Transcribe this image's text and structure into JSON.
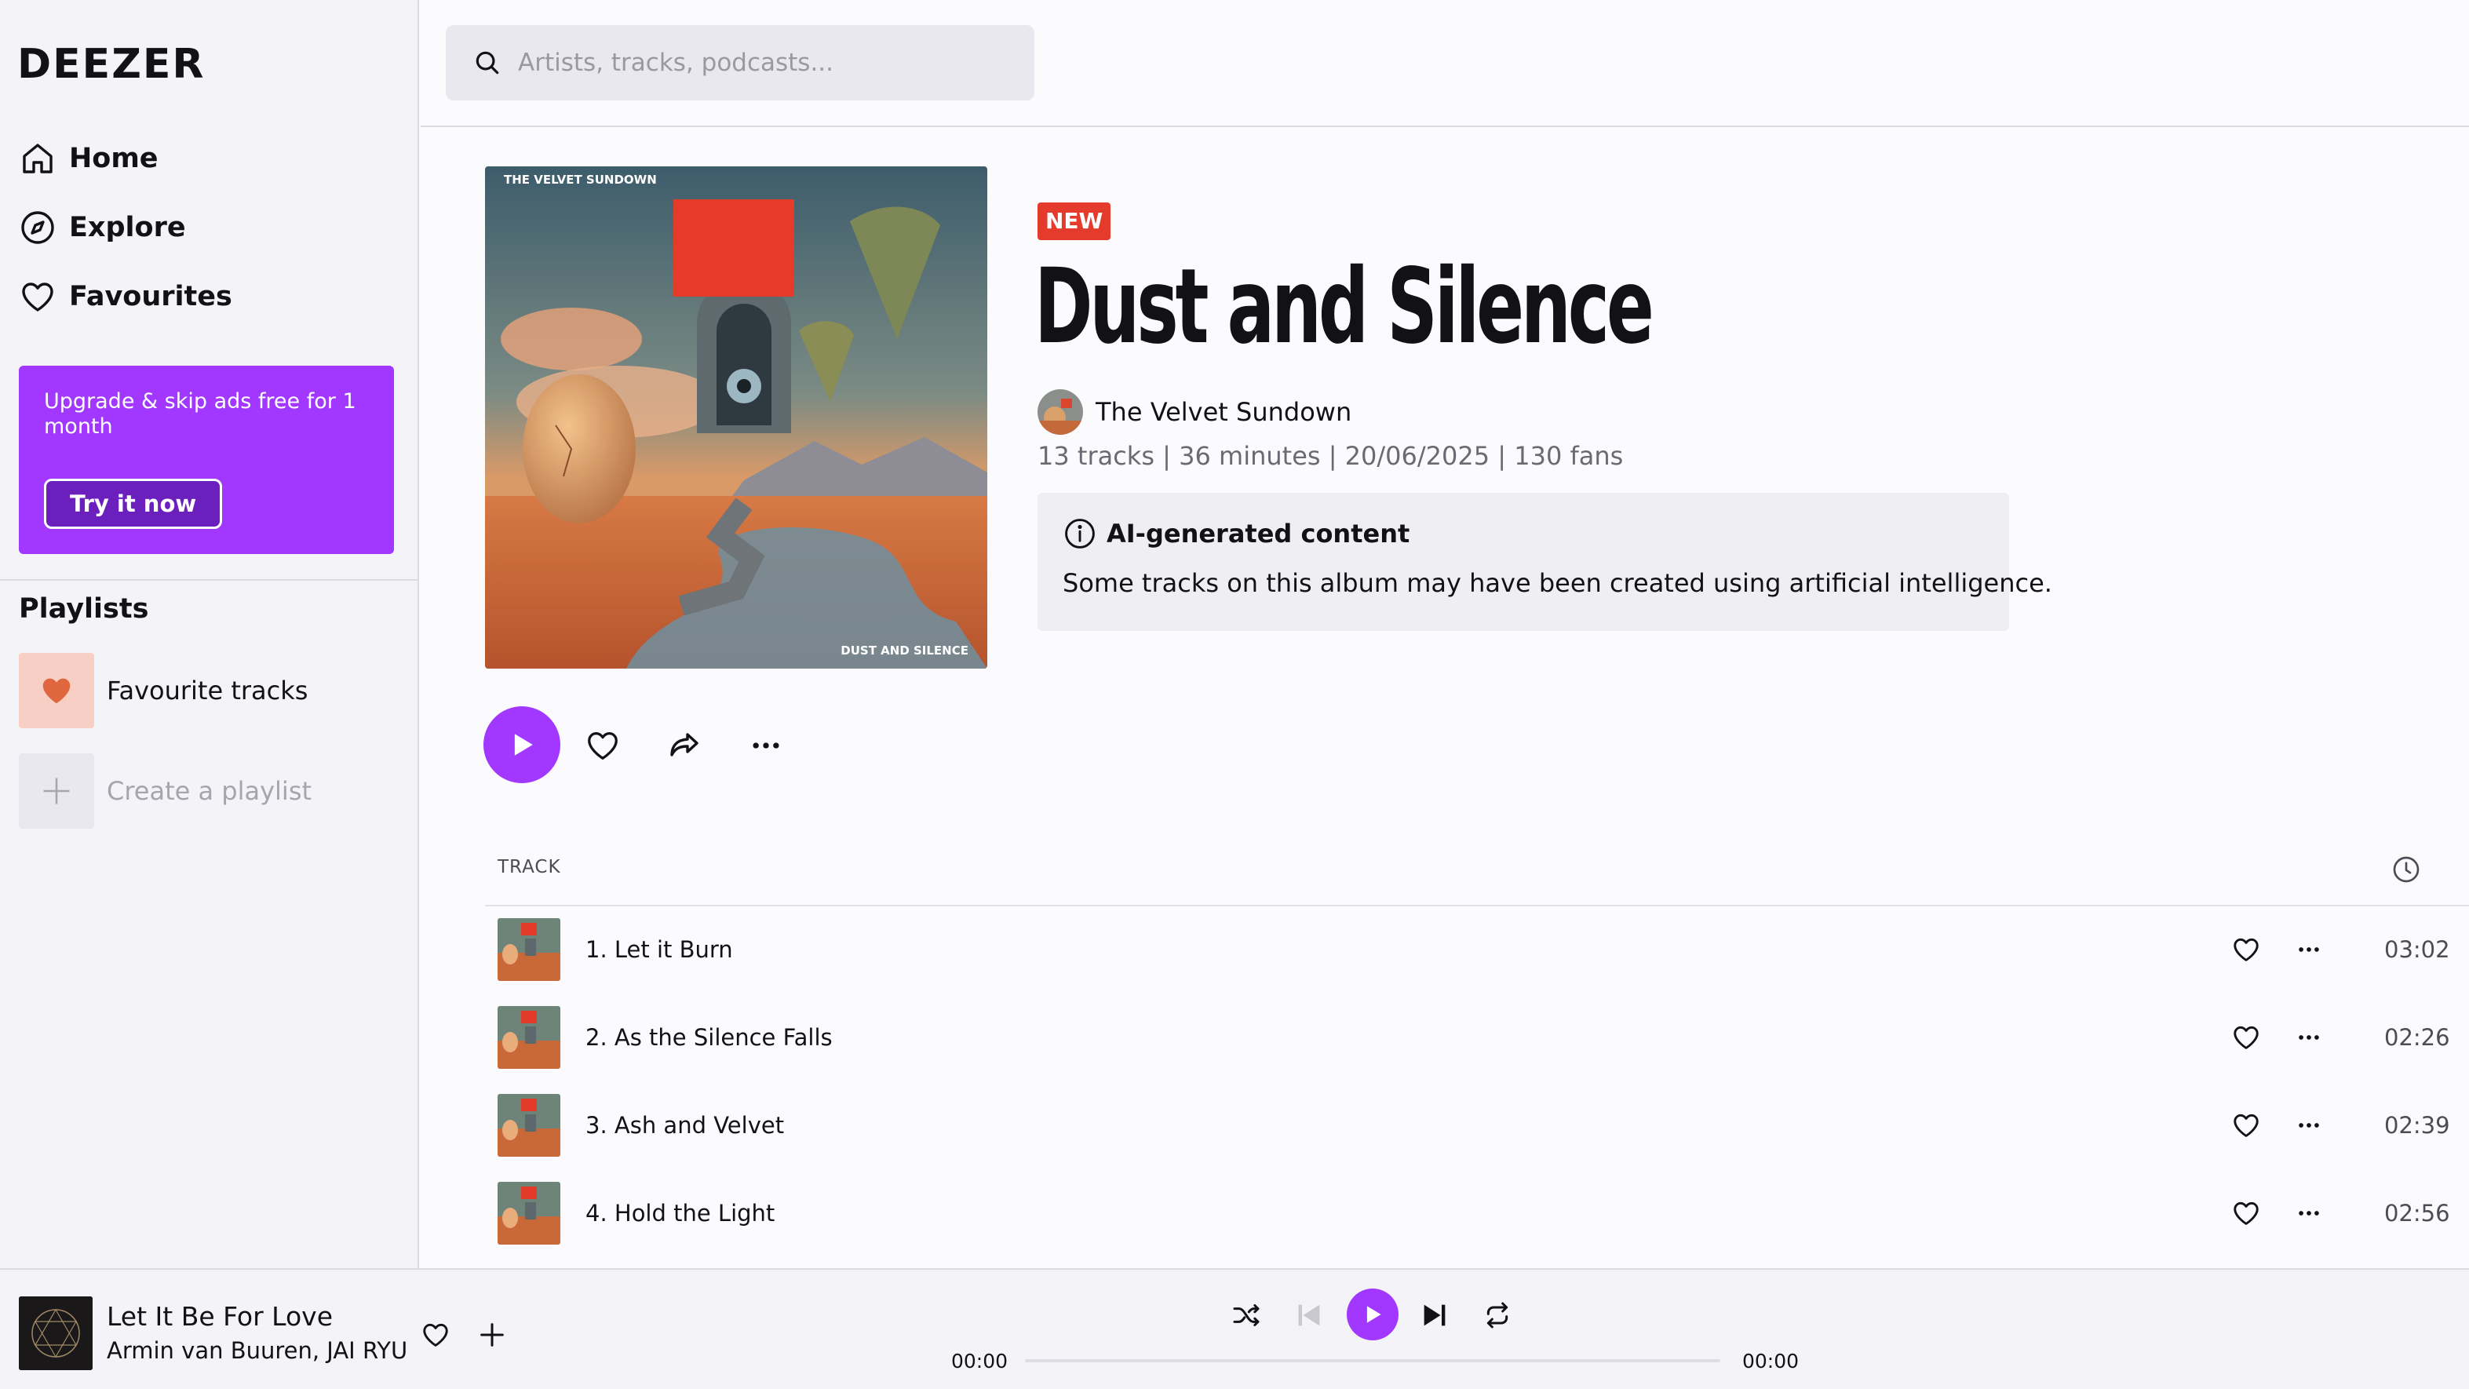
{
  "app": {
    "logo": "DEEZER",
    "accent_color": "#a238ff"
  },
  "sidebar": {
    "nav": [
      {
        "label": "Home",
        "icon": "home-icon"
      },
      {
        "label": "Explore",
        "icon": "compass-icon"
      },
      {
        "label": "Favourites",
        "icon": "heart-icon"
      }
    ],
    "promo": {
      "text": "Upgrade & skip ads free for 1 month",
      "button": "Try it now"
    },
    "playlists_title": "Playlists",
    "playlists": [
      {
        "label": "Favourite tracks",
        "icon": "heart-icon"
      },
      {
        "label": "Create a playlist",
        "icon": "plus-icon"
      }
    ]
  },
  "search": {
    "placeholder": "Artists, tracks, podcasts..."
  },
  "album": {
    "badge": "NEW",
    "title": "Dust and Silence",
    "artist": "The Velvet Sundown",
    "meta": "13 tracks | 36 minutes | 20/06/2025 | 130 fans",
    "cover_top_text": "THE VELVET SUNDOWN",
    "cover_bottom_text": "DUST AND SILENCE",
    "ai_notice": {
      "title": "AI-generated content",
      "body": "Some tracks on this album may have been created using artificial intelligence."
    }
  },
  "tracklist": {
    "column_track": "TRACK",
    "duration_icon": "clock-icon",
    "tracks": [
      {
        "title": "1. Let it Burn",
        "duration": "03:02"
      },
      {
        "title": "2. As the Silence Falls",
        "duration": "02:26"
      },
      {
        "title": "3. Ash and Velvet",
        "duration": "02:39"
      },
      {
        "title": "4. Hold the Light",
        "duration": "02:56"
      }
    ]
  },
  "player": {
    "title": "Let It Be For Love",
    "artist": "Armin van Buuren, JAI RYU",
    "elapsed": "00:00",
    "total": "00:00",
    "progress": 0
  }
}
